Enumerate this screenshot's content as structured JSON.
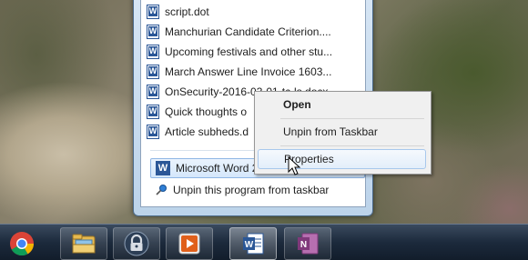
{
  "jumplist": {
    "recent_items": [
      {
        "label": "script.dot"
      },
      {
        "label": "Manchurian Candidate Criterion...."
      },
      {
        "label": "Upcoming festivals and other stu..."
      },
      {
        "label": "March Answer Line Invoice 1603..."
      },
      {
        "label": "OnSecurity-2016-03-01-tc-ls.docx"
      },
      {
        "label": "Quick thoughts o"
      },
      {
        "label": "Article subheds.d"
      }
    ],
    "program_label": "Microsoft Word 2010",
    "unpin_label": "Unpin this program from taskbar"
  },
  "context_menu": {
    "open": "Open",
    "unpin": "Unpin from Taskbar",
    "properties": "Properties"
  },
  "taskbar": {
    "buttons": [
      {
        "icon": "chrome-icon"
      },
      {
        "icon": "file-explorer-icon"
      },
      {
        "icon": "lock-icon"
      },
      {
        "icon": "media-player-icon"
      },
      {
        "icon": "word-icon",
        "letter": "W"
      },
      {
        "icon": "onenote-icon",
        "letter": "N"
      }
    ]
  },
  "colors": {
    "word_blue": "#2b5797",
    "onenote_purple": "#80397b",
    "taskbar": "#1c2a3c"
  }
}
